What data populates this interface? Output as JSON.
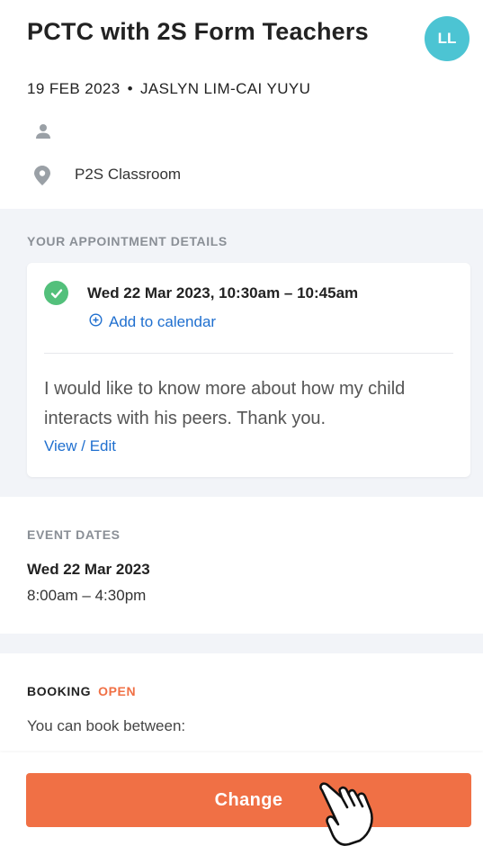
{
  "header": {
    "title": "PCTC with 2S Form Teachers",
    "avatar_initials": "LL",
    "date": "19 FEB 2023",
    "separator": "•",
    "organiser": "JASLYN LIM-CAI YUYU",
    "location": "P2S Classroom"
  },
  "appointment": {
    "section_label": "YOUR APPOINTMENT DETAILS",
    "time": "Wed 22 Mar 2023, 10:30am – 10:45am",
    "add_to_calendar": "Add to calendar",
    "note": "I would like to know more about how my child interacts with his peers. Thank you.",
    "view_edit": "View / Edit"
  },
  "event_dates": {
    "section_label": "EVENT DATES",
    "date": "Wed 22 Mar 2023",
    "time": "8:00am – 4:30pm"
  },
  "booking": {
    "label": "BOOKING",
    "status": "OPEN",
    "text": "You can book between:"
  },
  "actions": {
    "change_label": "Change"
  },
  "colors": {
    "accent": "#f07045",
    "link": "#1f6fcf",
    "avatar": "#4cc4d3",
    "success": "#53c07b",
    "band": "#f2f4f8"
  },
  "icons": [
    "person-icon",
    "location-pin-icon",
    "check-circle-icon",
    "add-circle-icon",
    "hand-pointer-icon"
  ]
}
